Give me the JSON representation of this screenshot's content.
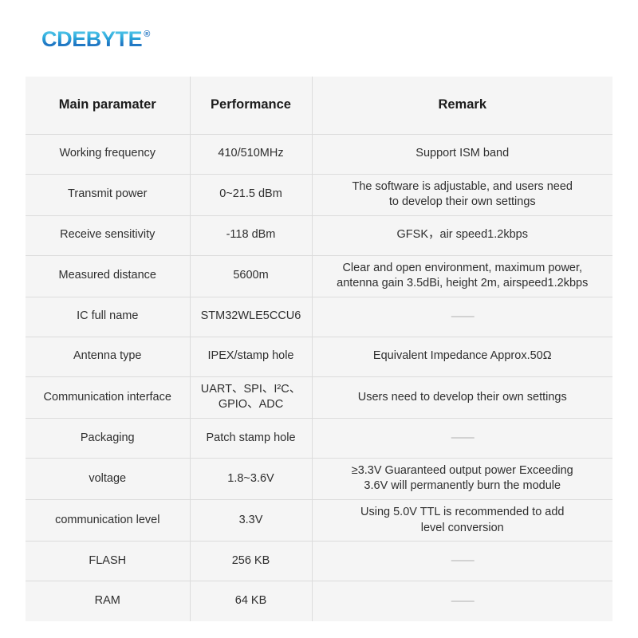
{
  "brand": {
    "name": "CDEBYTE",
    "trademark": "®",
    "gradient_start": "#5fd0ee",
    "gradient_end": "#1f74c2"
  },
  "table": {
    "headers": {
      "parameter": "Main paramater",
      "performance": "Performance",
      "remark": "Remark"
    },
    "placeholder_dash": "——",
    "rows": [
      {
        "parameter": "Working frequency",
        "performance": "410/510MHz",
        "remark": "Support  ISM band"
      },
      {
        "parameter": "Transmit power",
        "performance": "0~21.5 dBm",
        "remark": "The software is adjustable, and users need\nto develop their own settings"
      },
      {
        "parameter": "Receive sensitivity",
        "performance": "-118 dBm",
        "remark": "GFSK，air speed1.2kbps"
      },
      {
        "parameter": "Measured distance",
        "performance": "5600m",
        "remark": "Clear and open environment, maximum power,\nantenna gain 3.5dBi, height 2m, airspeed1.2kbps"
      },
      {
        "parameter": "IC full name",
        "performance": "STM32WLE5CCU6",
        "remark": "——"
      },
      {
        "parameter": "Antenna type",
        "performance": "IPEX/stamp hole",
        "remark": "Equivalent Impedance Approx.50Ω"
      },
      {
        "parameter": "Communication interface",
        "performance": "UART、SPI、I²C、\nGPIO、ADC",
        "remark": "Users need to develop their own settings"
      },
      {
        "parameter": "Packaging",
        "performance": "Patch stamp hole",
        "remark": "——"
      },
      {
        "parameter": "voltage",
        "performance": "1.8~3.6V",
        "remark": "≥3.3V Guaranteed output power Exceeding\n3.6V will permanently burn the module"
      },
      {
        "parameter": "communication level",
        "performance": "3.3V",
        "remark": "Using 5.0V TTL is recommended to add\nlevel conversion"
      },
      {
        "parameter": "FLASH",
        "performance": "256 KB",
        "remark": "——"
      },
      {
        "parameter": "RAM",
        "performance": "64 KB",
        "remark": "——"
      }
    ]
  }
}
